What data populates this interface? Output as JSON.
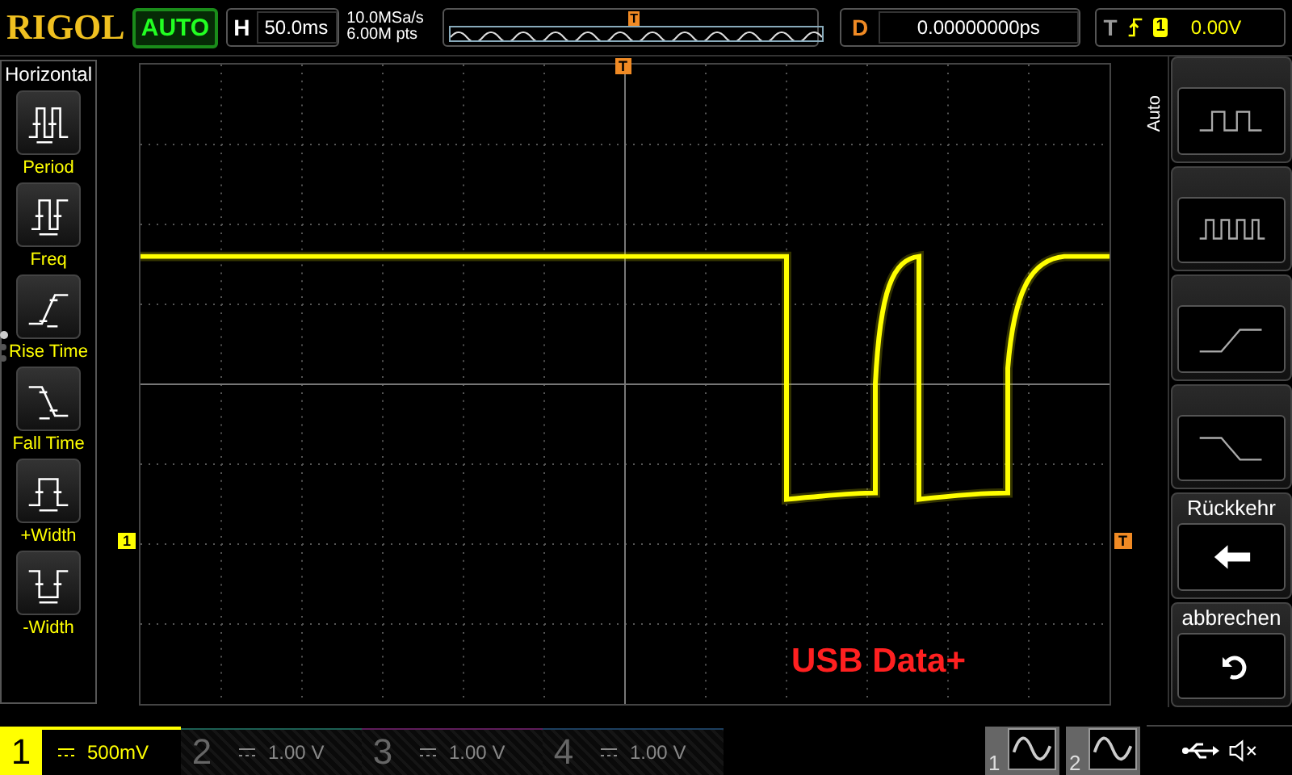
{
  "brand": "RIGOL",
  "run_state": "AUTO",
  "horizontal": {
    "label": "H",
    "timebase": "50.0ms"
  },
  "acquisition": {
    "sample_rate": "10.0MSa/s",
    "memory_depth": "6.00M pts"
  },
  "overview": {
    "marker": "T"
  },
  "delay": {
    "label": "D",
    "value": "0.00000000ps"
  },
  "trigger": {
    "label": "T",
    "source": "1",
    "level": "0.00V"
  },
  "left_menu": {
    "title": "Horizontal",
    "page_dots": [
      {
        "selected": true
      },
      {
        "selected": false
      },
      {
        "selected": false
      }
    ],
    "items": [
      {
        "kind": "period",
        "label": "Period"
      },
      {
        "kind": "freq",
        "label": "Freq"
      },
      {
        "kind": "rise",
        "label": "Rise Time"
      },
      {
        "kind": "fall",
        "label": "Fall Time"
      },
      {
        "kind": "pwidth",
        "label": "+Width"
      },
      {
        "kind": "nwidth",
        "label": "-Width"
      }
    ]
  },
  "right_menu": {
    "tab_label": "Auto",
    "buttons": [
      {
        "kind": "slow-pulse"
      },
      {
        "kind": "fast-pulse"
      },
      {
        "kind": "rising-edge"
      },
      {
        "kind": "falling-edge"
      },
      {
        "kind": "back",
        "label": "Rückkehr"
      },
      {
        "kind": "cancel",
        "label": "abbrechen"
      }
    ]
  },
  "markers": {
    "trigger_position": "T",
    "channel_ground": "1",
    "trigger_level": "T"
  },
  "overlay_text": "USB Data+",
  "channels": [
    {
      "number": "1",
      "scale": "500mV",
      "active": true,
      "color": "#ffff00"
    },
    {
      "number": "2",
      "scale": "1.00 V",
      "active": false,
      "color": "#1c5e52"
    },
    {
      "number": "3",
      "scale": "1.00 V",
      "active": false,
      "color": "#5e1c5a"
    },
    {
      "number": "4",
      "scale": "1.00 V",
      "active": false,
      "color": "#1c3e5e"
    }
  ],
  "generators": [
    {
      "number": "1"
    },
    {
      "number": "2"
    }
  ]
}
